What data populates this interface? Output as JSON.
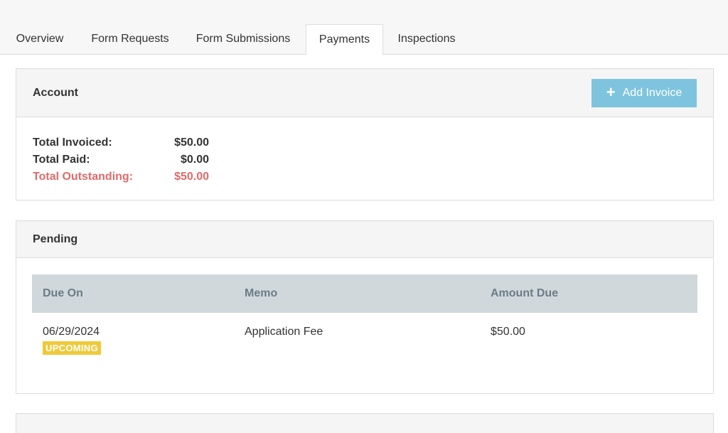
{
  "tabs": [
    {
      "label": "Overview",
      "active": false
    },
    {
      "label": "Form Requests",
      "active": false
    },
    {
      "label": "Form Submissions",
      "active": false
    },
    {
      "label": "Payments",
      "active": true
    },
    {
      "label": "Inspections",
      "active": false
    }
  ],
  "account": {
    "title": "Account",
    "add_invoice_label": "Add Invoice",
    "total_invoiced_label": "Total Invoiced:",
    "total_invoiced_value": "$50.00",
    "total_paid_label": "Total Paid:",
    "total_paid_value": "$0.00",
    "total_outstanding_label": "Total Outstanding:",
    "total_outstanding_value": "$50.00"
  },
  "pending": {
    "title": "Pending",
    "columns": [
      "Due On",
      "Memo",
      "Amount Due"
    ],
    "rows": [
      {
        "due_on": "06/29/2024",
        "status": "UPCOMING",
        "memo": "Application Fee",
        "amount_due": "$50.00"
      }
    ]
  },
  "colors": {
    "accent_button": "#7ec4de",
    "outstanding": "#e06a6a",
    "badge_upcoming": "#f0c93a",
    "table_header": "#d0d8dc"
  },
  "icons": {
    "add_invoice": "plus-icon"
  }
}
